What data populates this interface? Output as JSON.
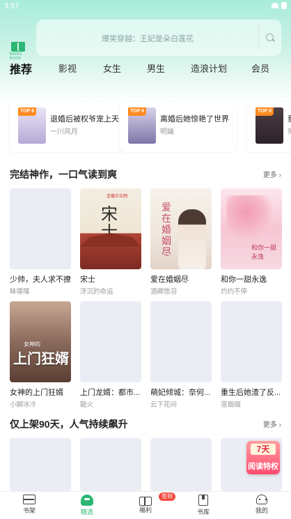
{
  "status": {
    "time": "3:57"
  },
  "search": {
    "placeholder": "爆笑穿越：王妃是朵白莲花"
  },
  "logo": {
    "text": "BAIDU BOOK"
  },
  "tabs": [
    "推荐",
    "影视",
    "女生",
    "男生",
    "造浪计划",
    "会员"
  ],
  "rank_cards": [
    {
      "badge": "TOP 8",
      "title": "退婚后被权爷宠上天",
      "author": "一川风月"
    },
    {
      "badge": "TOP 6",
      "title": "离婚后她惊艳了世界",
      "author": "明婳"
    },
    {
      "badge": "TOP 8",
      "title": "重",
      "author": "列"
    }
  ],
  "section1": {
    "title": "完结神作，一口气读到爽",
    "more": "更多 ›",
    "books": [
      {
        "title": "少帅，夫人求不撩",
        "author": "睐喋喋",
        "cover": ""
      },
      {
        "title": "宋士",
        "author": "浮沉的命运",
        "cover": "song",
        "cover_text": "宋士",
        "pub": "连载中文网"
      },
      {
        "title": "爱在婚姻尽",
        "author": "酒卿悠羽",
        "cover": "love",
        "cover_text": "爱在婚姻尽"
      },
      {
        "title": "和你一甜永逸",
        "author": "灼灼不停",
        "cover": "sweet",
        "cover_text": "和你一甜永逸"
      },
      {
        "title": "女神的上门狂婿",
        "author": "小脚冰冷",
        "cover": "god",
        "cover_text": "上门狂婿",
        "cover_small": "女神的"
      },
      {
        "title": "上门龙婿：都市...",
        "author": "龍火",
        "cover": ""
      },
      {
        "title": "萌妃倾城：奈何...",
        "author": "云下花间",
        "cover": ""
      },
      {
        "title": "重生后她渣了反...",
        "author": "落烟烟",
        "cover": ""
      }
    ]
  },
  "section2": {
    "title": "仅上架90天，人气持续飙升",
    "more": "更多 ›"
  },
  "float_badge": {
    "days": "7天",
    "text": "阅读特权"
  },
  "bottom_nav": [
    {
      "label": "书架",
      "icon": "bookshelf-icon"
    },
    {
      "label": "精选",
      "icon": "featured-icon",
      "active": true
    },
    {
      "label": "福利",
      "icon": "gift-icon",
      "badge": "签到"
    },
    {
      "label": "书库",
      "icon": "library-icon"
    },
    {
      "label": "我的",
      "icon": "profile-icon"
    }
  ],
  "colors": {
    "accent": "#2bb673",
    "badge": "#f04a3e",
    "rank_badge": "#ff8a1f"
  }
}
